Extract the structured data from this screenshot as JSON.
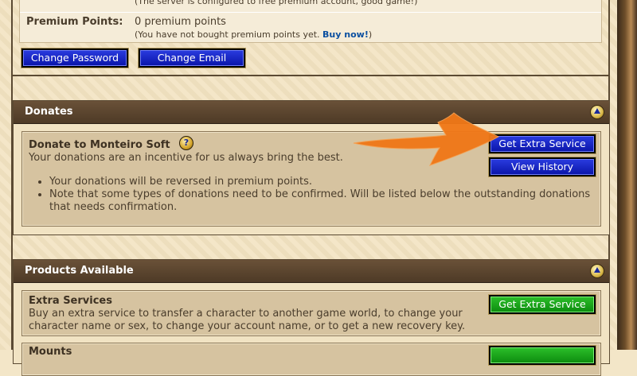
{
  "account": {
    "free_note": "(The server is configured to free premium account, good game!)",
    "premium_label": "Premium Points:",
    "premium_value": "0 premium points",
    "premium_note": "(You have not bought premium points yet.",
    "buy_now": "Buy now!",
    "premium_note_end": ")",
    "change_password": "Change Password",
    "change_email": "Change Email"
  },
  "donates": {
    "header": "Donates",
    "title": "Donate to Monteiro Soft",
    "help_icon": "?",
    "subtitle": "Your donations are an incentive for us always bring the best.",
    "notes": [
      "Your donations will be reversed in premium points.",
      "Note that some types of donations need to be confirmed. Will be listed below the outstanding donations that needs confirmation."
    ],
    "get_extra_service": "Get Extra Service",
    "view_history": "View History"
  },
  "products": {
    "header": "Products Available",
    "extra_title": "Extra Services",
    "extra_desc": "Buy an extra service to transfer a character to another game world, to change your character name or sex, to change your account name, or to get a new recovery key.",
    "extra_button": "Get Extra Service",
    "next_title": "Mounts"
  },
  "colors": {
    "button_blue": "#0a14a8",
    "button_green": "#0c8a0e",
    "header_brown": "#4e3a26",
    "annotation_arrow": "#f07818"
  }
}
